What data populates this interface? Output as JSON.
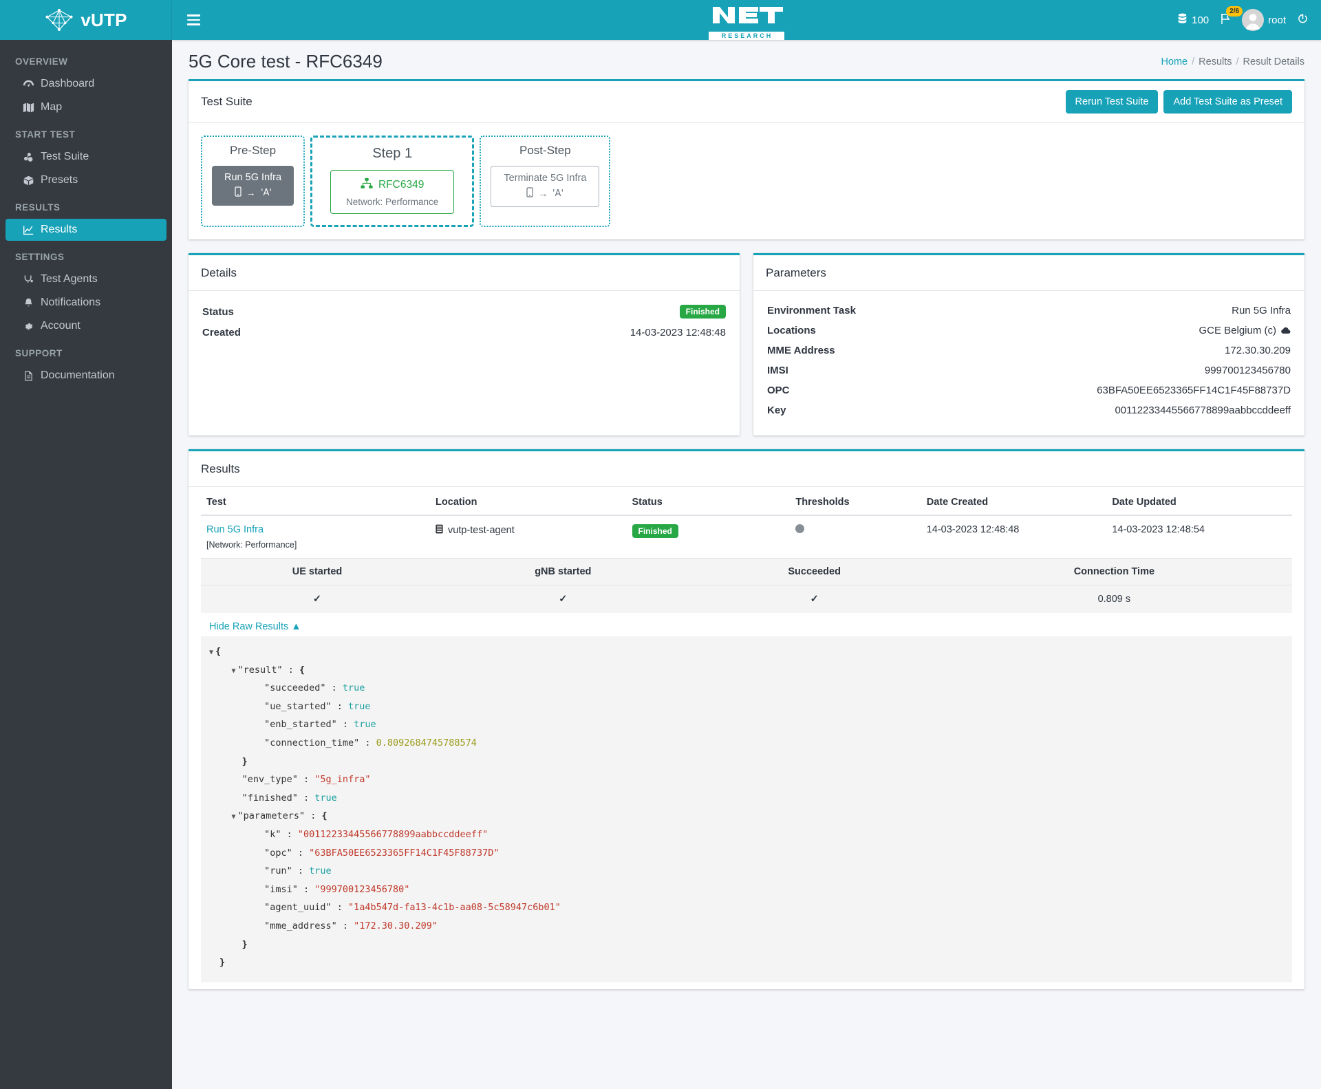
{
  "brand": {
    "name": "vUTP",
    "logo_icon": "network-nodes-icon"
  },
  "sidebar": {
    "sections": [
      {
        "header": "OVERVIEW",
        "items": [
          {
            "label": "Dashboard",
            "icon": "dashboard-icon",
            "active": false
          },
          {
            "label": "Map",
            "icon": "map-icon",
            "active": false
          }
        ]
      },
      {
        "header": "START TEST",
        "items": [
          {
            "label": "Test Suite",
            "icon": "test-suite-icon",
            "active": false
          },
          {
            "label": "Presets",
            "icon": "box-icon",
            "active": false
          }
        ]
      },
      {
        "header": "RESULTS",
        "items": [
          {
            "label": "Results",
            "icon": "chart-line-icon",
            "active": true
          }
        ]
      },
      {
        "header": "SETTINGS",
        "items": [
          {
            "label": "Test Agents",
            "icon": "agents-icon",
            "active": false
          },
          {
            "label": "Notifications",
            "icon": "bell-icon",
            "active": false
          },
          {
            "label": "Account",
            "icon": "gear-icon",
            "active": false
          }
        ]
      },
      {
        "header": "SUPPORT",
        "items": [
          {
            "label": "Documentation",
            "icon": "document-icon",
            "active": false
          }
        ]
      }
    ]
  },
  "topbar": {
    "menu_icon": "hamburger-icon",
    "logo_main": "NET",
    "logo_sub": "RESEARCH",
    "credits_icon": "database-icon",
    "credits": "100",
    "flag_icon": "flag-icon",
    "flag_badge": "2/6",
    "username": "root",
    "logout_icon": "power-icon"
  },
  "page": {
    "title": "5G Core test - RFC6349",
    "breadcrumb": {
      "home": "Home",
      "results": "Results",
      "current": "Result Details"
    }
  },
  "test_suite": {
    "title": "Test Suite",
    "rerun_label": "Rerun Test Suite",
    "preset_label": "Add Test Suite as Preset",
    "steps": [
      {
        "label": "Pre-Step",
        "kind": "task",
        "task_label": "Run 5G Infra",
        "current": false
      },
      {
        "label": "Step 1",
        "kind": "test",
        "test_name": "RFC6349",
        "test_sub": "Network: Performance",
        "current": true
      },
      {
        "label": "Post-Step",
        "kind": "task_outline",
        "task_label": "Terminate 5G Infra",
        "current": false
      }
    ]
  },
  "details": {
    "title": "Details",
    "rows": [
      {
        "key": "Status",
        "value": "Finished",
        "badge": true
      },
      {
        "key": "Created",
        "value": "14-03-2023 12:48:48",
        "badge": false
      }
    ]
  },
  "parameters": {
    "title": "Parameters",
    "rows": [
      {
        "key": "Environment Task",
        "value": "Run 5G Infra"
      },
      {
        "key": "Locations",
        "value": "GCE Belgium (c)"
      },
      {
        "key": "MME Address",
        "value": "172.30.30.209"
      },
      {
        "key": "IMSI",
        "value": "999700123456780"
      },
      {
        "key": "OPC",
        "value": "63BFA50EE6523365FF14C1F45F88737D"
      },
      {
        "key": "Key",
        "value": "00112233445566778899aabbccddeeff"
      }
    ]
  },
  "results": {
    "title": "Results",
    "columns": [
      "Test",
      "Location",
      "Status",
      "Thresholds",
      "Date Created",
      "Date Updated"
    ],
    "row": {
      "test": "Run 5G Infra",
      "test_note": "[Network: Performance]",
      "location": "vutp-test-agent",
      "status": "Finished",
      "date_created": "14-03-2023 12:48:48",
      "date_updated": "14-03-2023 12:48:54"
    },
    "sub_table": {
      "columns": [
        "UE started",
        "gNB started",
        "Succeeded",
        "Connection Time"
      ],
      "values": [
        "✓",
        "✓",
        "✓",
        "0.809 s"
      ]
    },
    "raw_toggle": "Hide Raw Results",
    "raw_json_lines": [
      {
        "indent": 0,
        "caret": true,
        "parts": [
          {
            "t": "punc",
            "v": "{"
          }
        ]
      },
      {
        "indent": 1,
        "caret": true,
        "parts": [
          {
            "t": "key",
            "v": "\"result\" : "
          },
          {
            "t": "punc",
            "v": "{"
          }
        ]
      },
      {
        "indent": 2,
        "caret": false,
        "parts": [
          {
            "t": "key",
            "v": "\"succeeded\" : "
          },
          {
            "t": "bool",
            "v": "true"
          }
        ]
      },
      {
        "indent": 2,
        "caret": false,
        "parts": [
          {
            "t": "key",
            "v": "\"ue_started\" : "
          },
          {
            "t": "bool",
            "v": "true"
          }
        ]
      },
      {
        "indent": 2,
        "caret": false,
        "parts": [
          {
            "t": "key",
            "v": "\"enb_started\" : "
          },
          {
            "t": "bool",
            "v": "true"
          }
        ]
      },
      {
        "indent": 2,
        "caret": false,
        "parts": [
          {
            "t": "key",
            "v": "\"connection_time\" : "
          },
          {
            "t": "num",
            "v": "0.8092684745788574"
          }
        ]
      },
      {
        "indent": 1,
        "caret": false,
        "parts": [
          {
            "t": "punc",
            "v": "}"
          }
        ]
      },
      {
        "indent": 1,
        "caret": false,
        "parts": [
          {
            "t": "key",
            "v": "\"env_type\" : "
          },
          {
            "t": "str",
            "v": "\"5g_infra\""
          }
        ]
      },
      {
        "indent": 1,
        "caret": false,
        "parts": [
          {
            "t": "key",
            "v": "\"finished\" : "
          },
          {
            "t": "bool",
            "v": "true"
          }
        ]
      },
      {
        "indent": 1,
        "caret": true,
        "parts": [
          {
            "t": "key",
            "v": "\"parameters\" : "
          },
          {
            "t": "punc",
            "v": "{"
          }
        ]
      },
      {
        "indent": 2,
        "caret": false,
        "parts": [
          {
            "t": "key",
            "v": "\"k\" : "
          },
          {
            "t": "str",
            "v": "\"00112233445566778899aabbccddeeff\""
          }
        ]
      },
      {
        "indent": 2,
        "caret": false,
        "parts": [
          {
            "t": "key",
            "v": "\"opc\" : "
          },
          {
            "t": "str",
            "v": "\"63BFA50EE6523365FF14C1F45F88737D\""
          }
        ]
      },
      {
        "indent": 2,
        "caret": false,
        "parts": [
          {
            "t": "key",
            "v": "\"run\" : "
          },
          {
            "t": "bool",
            "v": "true"
          }
        ]
      },
      {
        "indent": 2,
        "caret": false,
        "parts": [
          {
            "t": "key",
            "v": "\"imsi\" : "
          },
          {
            "t": "str",
            "v": "\"999700123456780\""
          }
        ]
      },
      {
        "indent": 2,
        "caret": false,
        "parts": [
          {
            "t": "key",
            "v": "\"agent_uuid\" : "
          },
          {
            "t": "str",
            "v": "\"1a4b547d-fa13-4c1b-aa08-5c58947c6b01\""
          }
        ]
      },
      {
        "indent": 2,
        "caret": false,
        "parts": [
          {
            "t": "key",
            "v": "\"mme_address\" : "
          },
          {
            "t": "str",
            "v": "\"172.30.30.209\""
          }
        ]
      },
      {
        "indent": 1,
        "caret": false,
        "parts": [
          {
            "t": "punc",
            "v": "}"
          }
        ]
      },
      {
        "indent": 0,
        "caret": false,
        "parts": [
          {
            "t": "punc",
            "v": "}"
          }
        ]
      }
    ]
  },
  "colors": {
    "accent": "#17a2b8",
    "sidebar": "#343a40",
    "success": "#28a745",
    "warning": "#ffc107"
  }
}
